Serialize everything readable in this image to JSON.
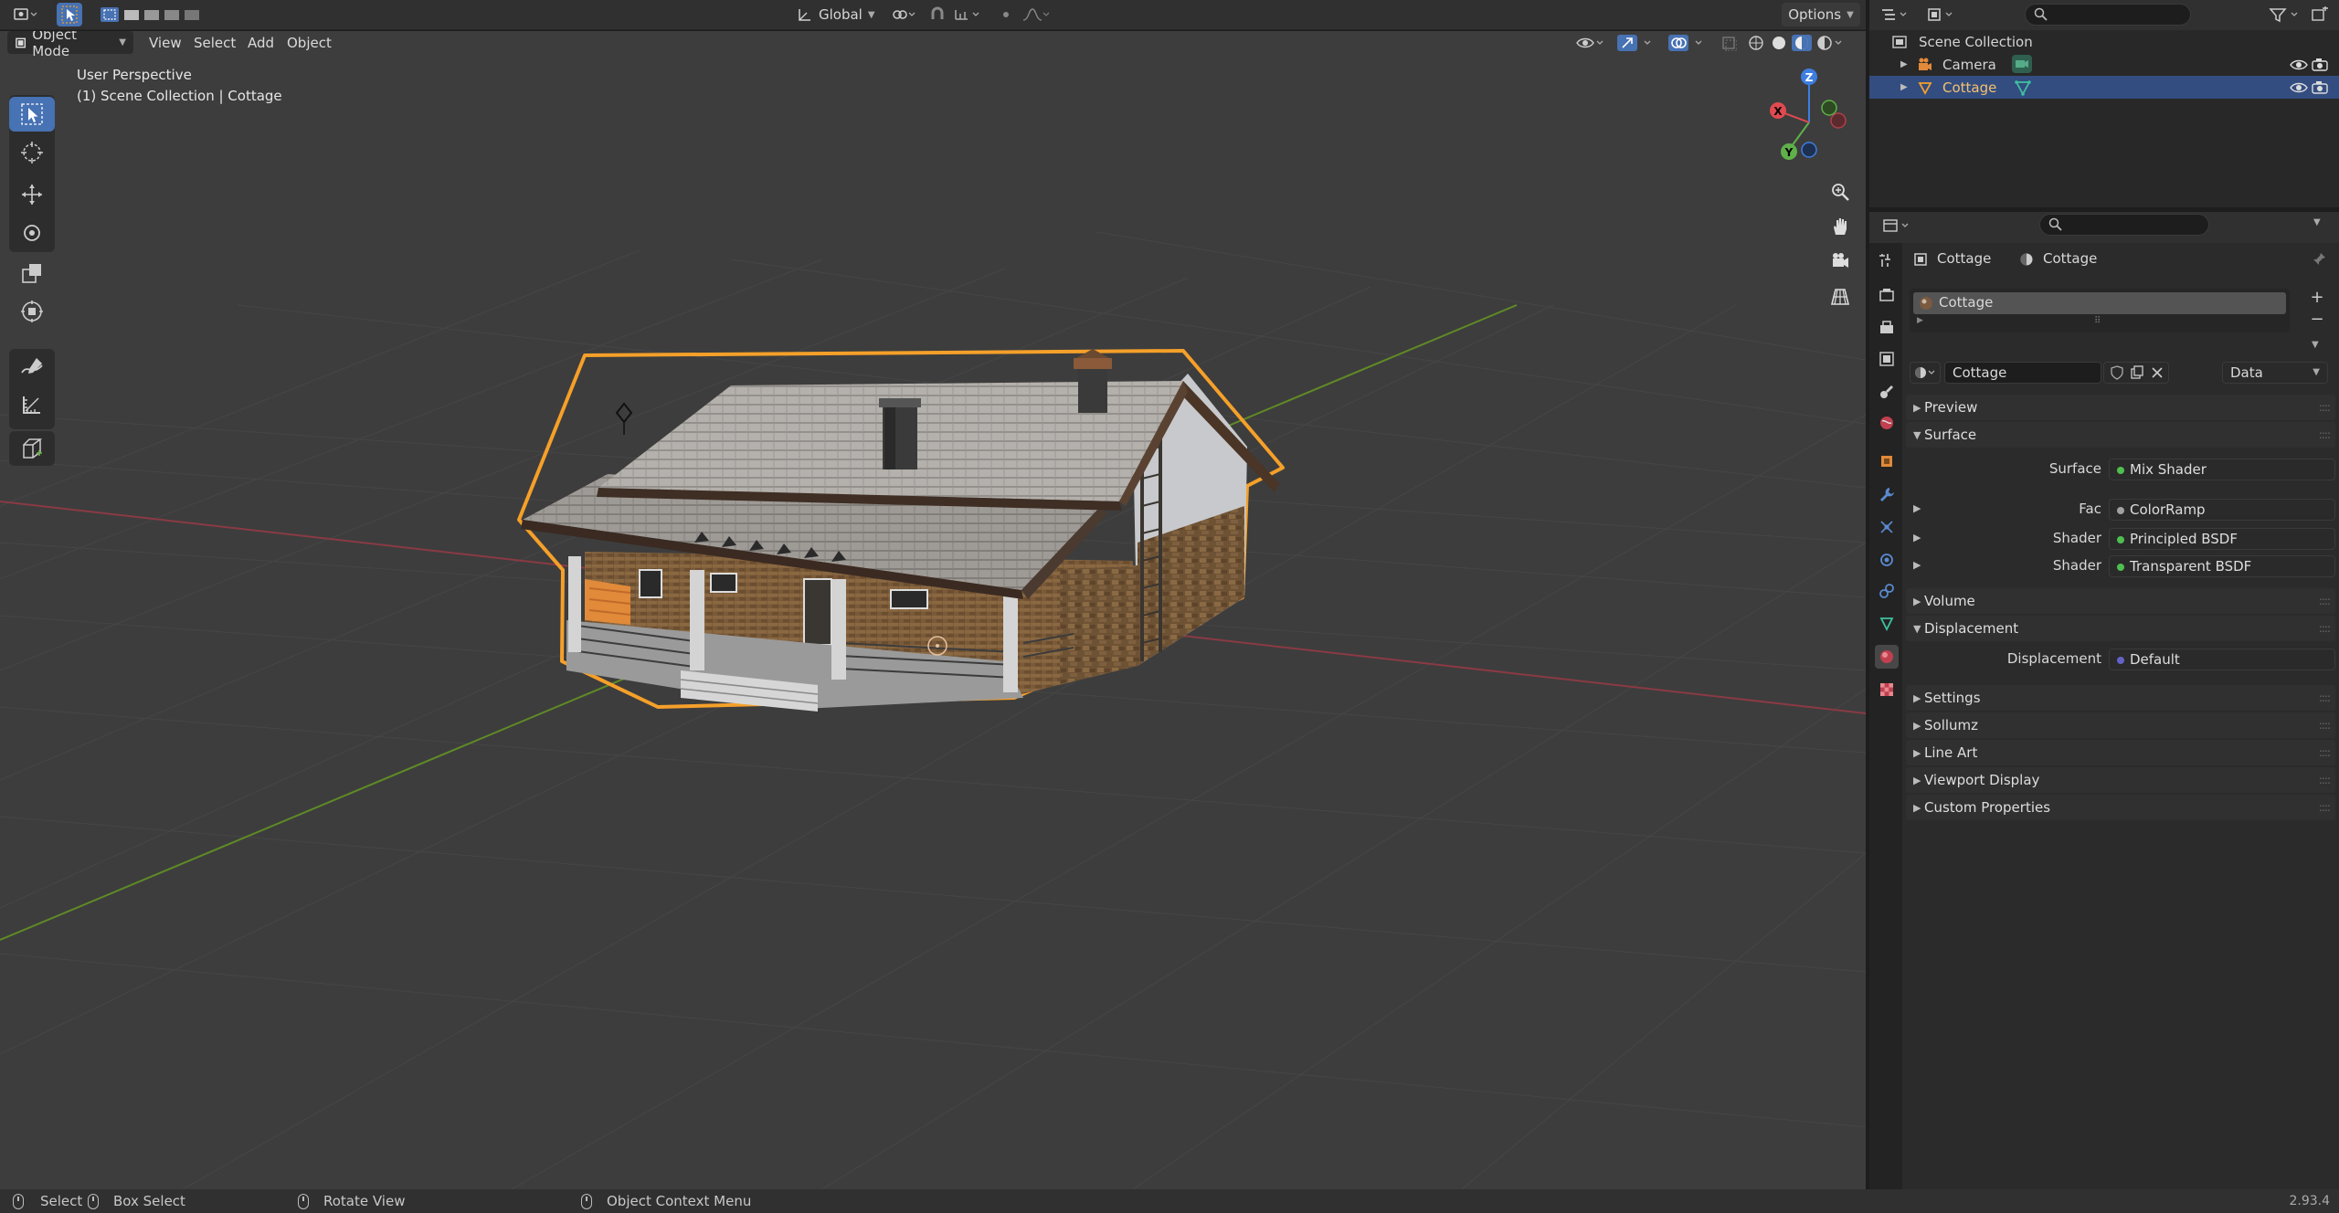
{
  "header": {
    "transform_orientation": "Global",
    "options_label": "Options"
  },
  "viewport_header": {
    "mode": "Object Mode",
    "menus": [
      "View",
      "Select",
      "Add",
      "Object"
    ]
  },
  "viewport": {
    "overlay_line1": "User Perspective",
    "overlay_line2": "(1) Scene Collection | Cottage",
    "gizmo_axes": {
      "x": "X",
      "y": "Y",
      "z": "Z"
    }
  },
  "outliner": {
    "root": "Scene Collection",
    "items": [
      {
        "label": "Camera",
        "selected": false
      },
      {
        "label": "Cottage",
        "selected": true
      }
    ]
  },
  "properties": {
    "breadcrumb_object": "Cottage",
    "breadcrumb_material": "Cottage",
    "material_slot": "Cottage",
    "material_name": "Cottage",
    "link_mode": "Data",
    "panels": {
      "preview": "Preview",
      "surface": "Surface",
      "volume": "Volume",
      "displacement": "Displacement",
      "settings": "Settings",
      "sollumz": "Sollumz",
      "line_art": "Line Art",
      "viewport_display": "Viewport Display",
      "custom_properties": "Custom Properties"
    },
    "surface_rows": [
      {
        "label": "Surface",
        "value": "Mix Shader",
        "color": "#4fbf4f"
      },
      {
        "label": "Fac",
        "value": "ColorRamp",
        "color": "#a1a1a1"
      },
      {
        "label": "Shader",
        "value": "Principled BSDF",
        "color": "#4fbf4f"
      },
      {
        "label": "Shader",
        "value": "Transparent BSDF",
        "color": "#4fbf4f"
      }
    ],
    "displacement_row": {
      "label": "Displacement",
      "value": "Default",
      "color": "#6363c7"
    }
  },
  "statusbar": {
    "select": "Select",
    "box_select": "Box Select",
    "rotate_view": "Rotate View",
    "context_menu": "Object Context Menu",
    "version": "2.93.4"
  },
  "colors": {
    "accent": "#4772b3",
    "selection_outline": "#f5a02a",
    "x_axis": "#b33e4a",
    "y_axis": "#6f9a2b"
  }
}
